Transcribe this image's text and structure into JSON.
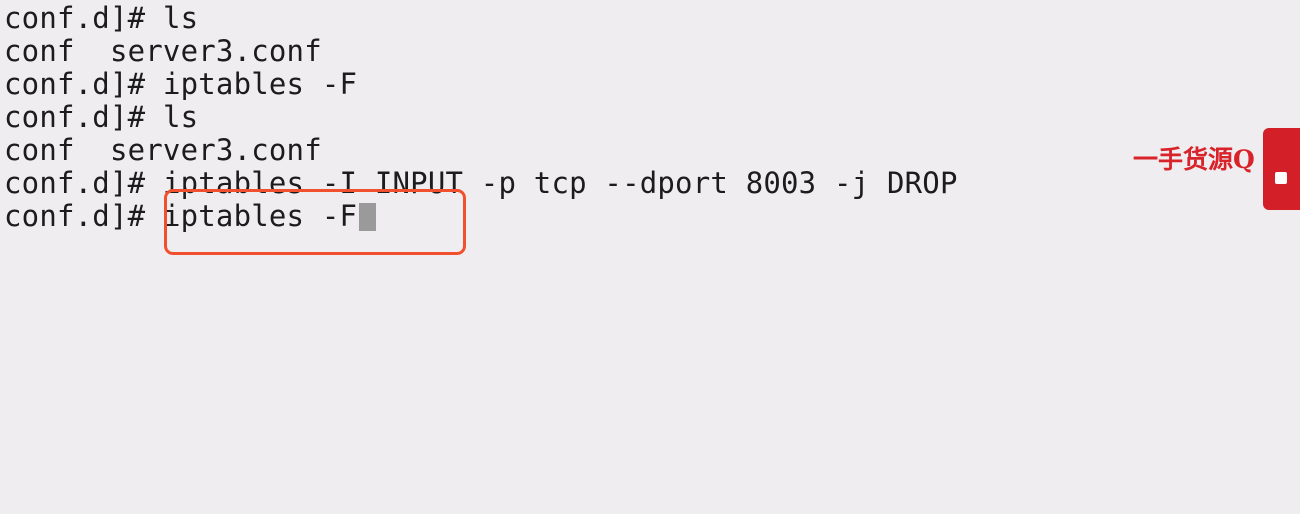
{
  "terminal": {
    "lines": [
      {
        "prompt": "conf.d]# ",
        "command": "ls"
      },
      {
        "output": "conf  server3.conf"
      },
      {
        "prompt": "conf.d]# ",
        "command": "iptables -F"
      },
      {
        "prompt": "conf.d]# ",
        "command": "ls"
      },
      {
        "output": "conf  server3.conf"
      },
      {
        "prompt": "conf.d]# ",
        "command": "iptables -I INPUT -p tcp --dport 8003 -j DROP"
      },
      {
        "prompt": "conf.d]# ",
        "command": "iptables -F"
      }
    ]
  },
  "watermark": {
    "text": "一手货源Q"
  },
  "colors": {
    "background": "#efedf0",
    "text": "#1c1c1c",
    "highlight": "#f0502e",
    "watermark": "#d8232a"
  }
}
